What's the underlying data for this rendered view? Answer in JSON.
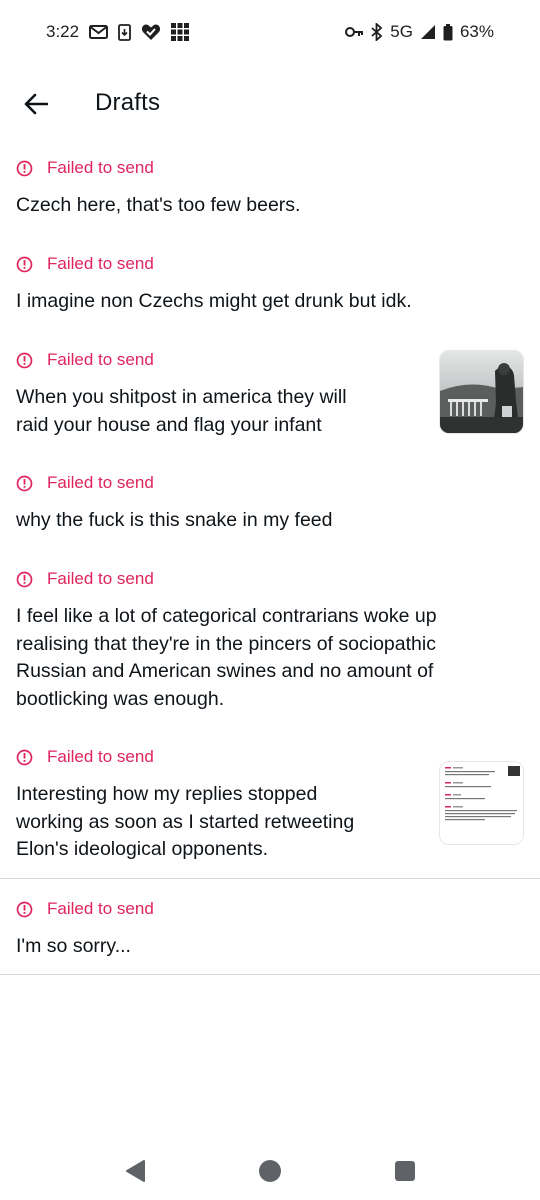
{
  "status_bar": {
    "time": "3:22",
    "network": "5G",
    "battery": "63%"
  },
  "header": {
    "title": "Drafts"
  },
  "drafts": [
    {
      "status": "Failed to send",
      "text": "Czech here, that's too few beers."
    },
    {
      "status": "Failed to send",
      "text": "I imagine non Czechs might get drunk but idk."
    },
    {
      "status": "Failed to send",
      "lines": [
        "When you shitpost in america they will",
        "raid your house and flag your infant"
      ]
    },
    {
      "status": "Failed to send",
      "text": "why the fuck is this snake in my feed"
    },
    {
      "status": "Failed to send",
      "lines": [
        "I feel like a lot of categorical contrarians woke up",
        "realising that they're in the pincers of sociopathic",
        "Russian and American swines and no amount of",
        "bootlicking was enough."
      ]
    },
    {
      "status": "Failed to send",
      "lines": [
        "Interesting how my replies stopped",
        "working as soon as I started retweeting",
        "Elon's ideological opponents."
      ]
    },
    {
      "status": "Failed to send",
      "text": "I'm so sorry..."
    }
  ],
  "colors": {
    "error": "#e0245e",
    "text": "#0f1419",
    "divider": "#d9d9d9"
  },
  "icons": {
    "back": "arrow-left-icon",
    "status": "alert-circle-icon",
    "nav": [
      "back-triangle-icon",
      "home-circle-icon",
      "recents-square-icon"
    ]
  }
}
